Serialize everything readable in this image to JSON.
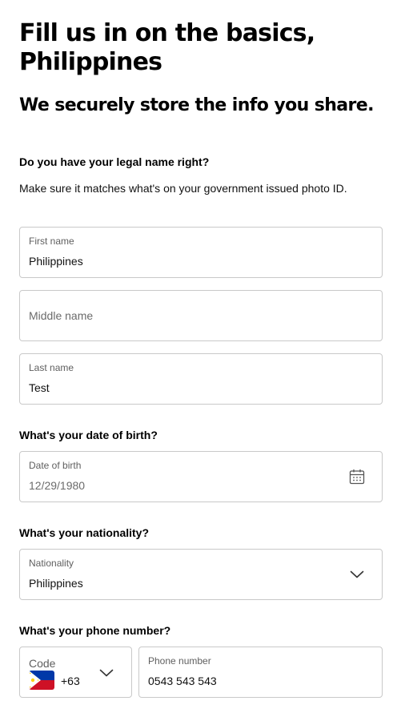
{
  "header": {
    "title": "Fill us in on the basics, Philippines",
    "subtitle": "We securely store the info you share."
  },
  "name_section": {
    "question": "Do you have your legal name right?",
    "help": "Make sure it matches what's on your government issued photo ID.",
    "first_name": {
      "label": "First name",
      "value": "Philippines"
    },
    "middle_name": {
      "placeholder": "Middle name"
    },
    "last_name": {
      "label": "Last name",
      "value": "Test"
    }
  },
  "dob_section": {
    "question": "What's your date of birth?",
    "label": "Date of birth",
    "value": "12/29/1980",
    "icon": "calendar-icon"
  },
  "nationality_section": {
    "question": "What's your nationality?",
    "label": "Nationality",
    "value": "Philippines",
    "icon": "chevron-down-icon"
  },
  "phone_section": {
    "question": "What's your phone number?",
    "code_label": "Code",
    "code_value": "+63",
    "flag": "philippines-flag-icon",
    "number_label": "Phone number",
    "number_value": "0543 543 543"
  },
  "colors": {
    "border": "#c9c9c9",
    "label": "#5f5f5f",
    "text": "#111111"
  }
}
